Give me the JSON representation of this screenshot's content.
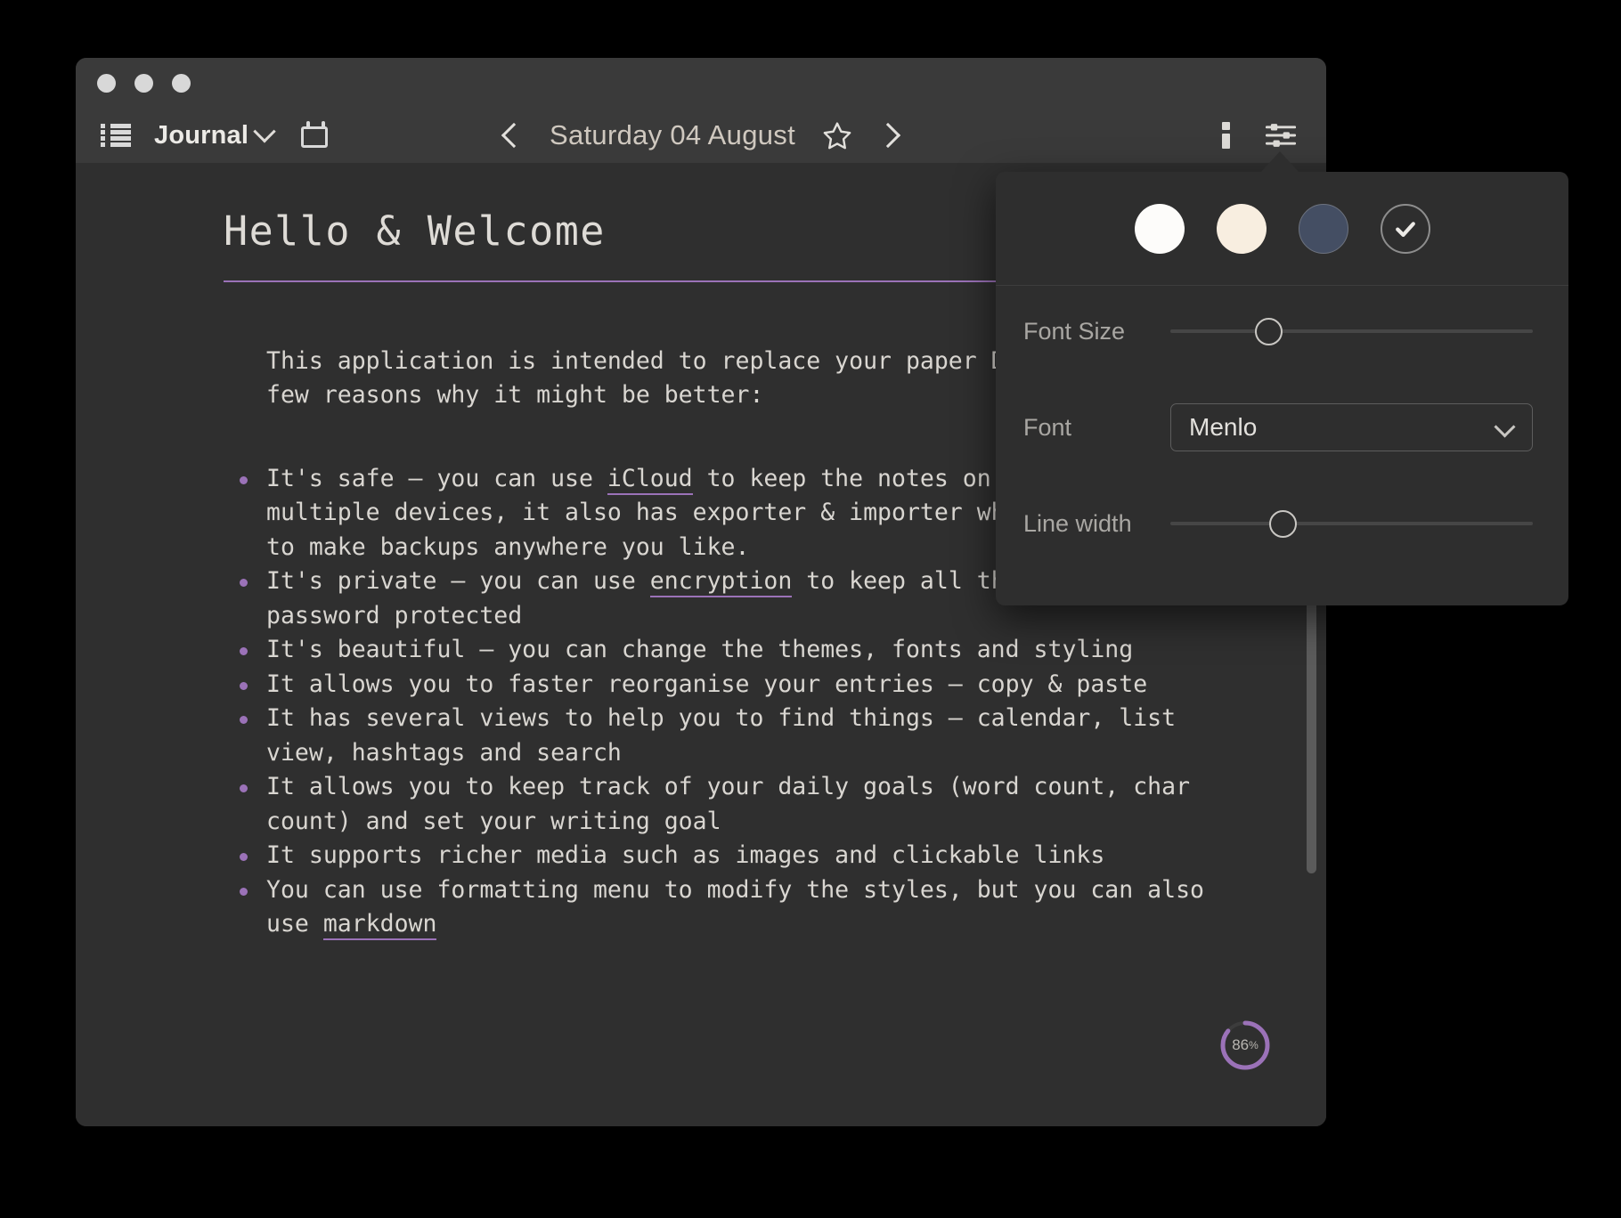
{
  "window": {
    "traffic_lights": [
      "close",
      "minimize",
      "zoom"
    ]
  },
  "toolbar": {
    "list_view_icon": "list-icon",
    "journal_label": "Journal",
    "journal_chevron": "chevron-down-icon",
    "calendar_icon": "calendar-icon",
    "prev_label": "previous-day",
    "date": "Saturday 04 August",
    "star_icon": "star-outline-icon",
    "next_label": "next-day",
    "info_icon": "info-icon",
    "settings_icon": "sliders-icon"
  },
  "document": {
    "title": "Hello & Welcome",
    "intro": "This application is intended to replace your paper Diary. There are a\nfew reasons why it might be better:",
    "bullets": [
      {
        "segments": [
          {
            "text": "It's safe — you can use ",
            "link": false
          },
          {
            "text": "iCloud",
            "link": true
          },
          {
            "text": " to keep the notes on cloud and sync between\nmultiple devices, it also has exporter & importer which allows you\nto make backups anywhere you like.",
            "link": false
          }
        ]
      },
      {
        "segments": [
          {
            "text": "It's private — you can use ",
            "link": false
          },
          {
            "text": "encryption",
            "link": true
          },
          {
            "text": " to keep all the entries\npassword protected",
            "link": false
          }
        ]
      },
      {
        "segments": [
          {
            "text": "It's beautiful — you can change the themes, fonts and styling",
            "link": false
          }
        ]
      },
      {
        "segments": [
          {
            "text": "It allows you to faster reorganise your entries — copy & paste",
            "link": false
          }
        ]
      },
      {
        "segments": [
          {
            "text": "It has several views to help you to find things — calendar, list\nview, hashtags and search",
            "link": false
          }
        ]
      },
      {
        "segments": [
          {
            "text": "It allows you to keep track of your daily goals (word count, char\ncount) and set your writing goal",
            "link": false
          }
        ]
      },
      {
        "segments": [
          {
            "text": "It supports richer media such as images and clickable links",
            "link": false
          }
        ]
      },
      {
        "segments": [
          {
            "text": "You can use formatting menu to modify the styles, but you can also\nuse ",
            "link": false
          },
          {
            "text": "markdown",
            "link": true
          }
        ]
      }
    ]
  },
  "progress": {
    "value": 86,
    "number": "86",
    "unit": "%"
  },
  "settings_panel": {
    "themes": [
      {
        "name": "light",
        "color": "#fdfcfa",
        "selected": false
      },
      {
        "name": "cream",
        "color": "#f8eee0",
        "selected": false
      },
      {
        "name": "navy",
        "color": "#444e63",
        "selected": false
      },
      {
        "name": "dark",
        "color": "#2e2e2e",
        "selected": true
      }
    ],
    "font_size": {
      "label": "Font Size",
      "percent": 27
    },
    "font": {
      "label": "Font",
      "value": "Menlo",
      "chevron": "chevron-down-icon"
    },
    "line_width": {
      "label": "Line width",
      "percent": 31
    }
  },
  "colors": {
    "accent_purple": "#9b72b8",
    "window_chrome": "#3a3a3a",
    "document_bg": "#2f2f2f",
    "popover_bg": "#2e2e2e",
    "text_primary": "#d9d6d1"
  }
}
